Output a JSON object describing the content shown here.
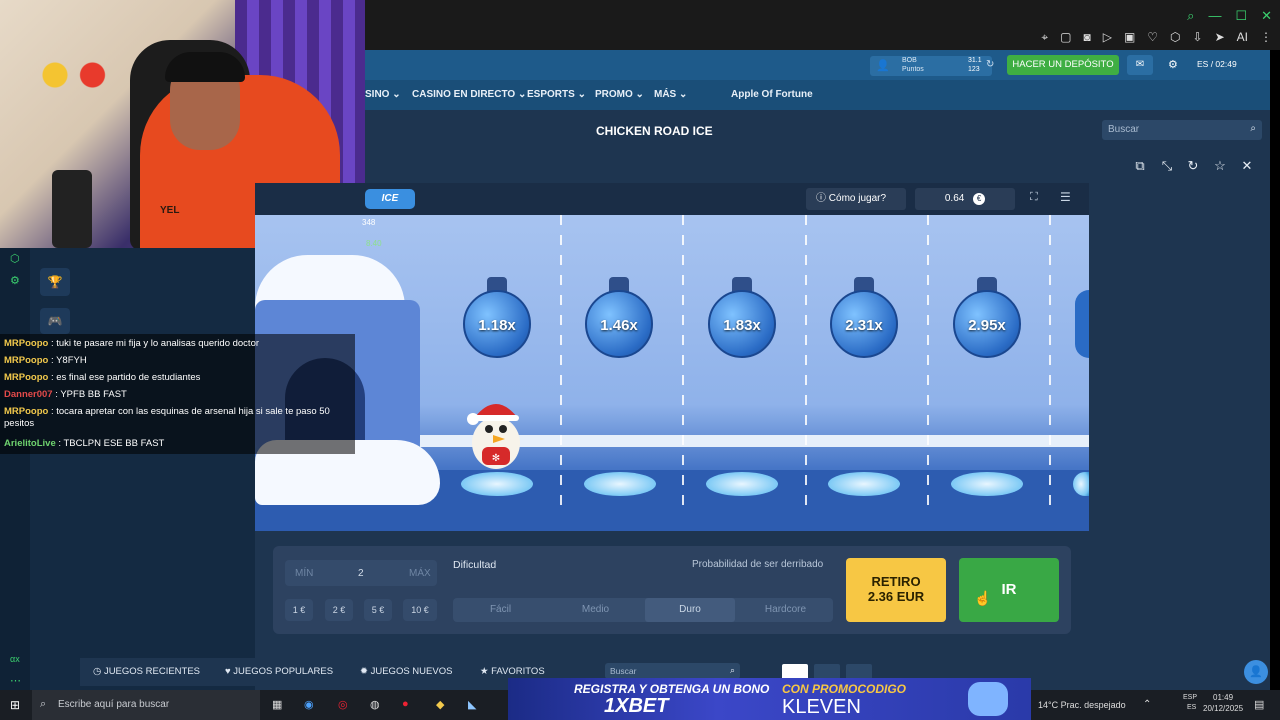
{
  "header": {
    "currency": "BOB",
    "points_label": "Puntos",
    "balance_top": "31.1",
    "balance_bottom": "123",
    "deposit_button": "HACER UN DEPÓSITO",
    "lang_time": "ES / 02:49"
  },
  "nav": {
    "items": [
      "SINO",
      "CASINO EN DIRECTO",
      "ESPORTS",
      "PROMO",
      "MÁS"
    ],
    "apple_label": "Apple Of Fortune"
  },
  "page": {
    "title": "CHICKEN ROAD ICE",
    "search_placeholder": "Buscar"
  },
  "game": {
    "logo_text": "ICE",
    "how_to_play": "Cómo jugar?",
    "balance": "0.64",
    "currency_icon": "€",
    "multipliers": [
      "1.18x",
      "1.46x",
      "1.83x",
      "2.31x",
      "2.95x"
    ],
    "overlay_id": "348",
    "overlay_win": "8.40"
  },
  "controls": {
    "min_label": "MÍN",
    "bet_value": "2",
    "max_label": "MÁX",
    "quick_bets": [
      "1",
      "2",
      "5",
      "10"
    ],
    "difficulty_label": "Dificultad",
    "shot_label": "Probabilidad de ser derribado",
    "difficulties": [
      "Fácil",
      "Medio",
      "Duro",
      "Hardcore"
    ],
    "selected_difficulty": "Duro",
    "cashout_line1": "RETIRO",
    "cashout_line2": "2.36 EUR",
    "go_button": "IR"
  },
  "bottom_nav": {
    "recent": "JUEGOS RECIENTES",
    "popular": "JUEGOS POPULARES",
    "new": "JUEGOS NUEVOS",
    "favorites": "FAVORITOS",
    "search_placeholder": "Buscar"
  },
  "chat": [
    {
      "user": "MRPoopo",
      "msg": " : tuki te pasare mi fija y lo analisas querido doctor",
      "style": "u"
    },
    {
      "user": "MRPoopo",
      "msg": " : Y8FYH",
      "style": "u"
    },
    {
      "user": "MRPoopo",
      "msg": " : es final ese partido de estudiantes",
      "style": "u"
    },
    {
      "user": "Danner007",
      "msg": " : YPFB BB FAST",
      "style": "u2"
    },
    {
      "user": "MRPoopo",
      "msg": " : tocara apretar con las esquinas de arsenal hija si sale te paso 50 pesitos",
      "style": "u"
    },
    {
      "user": "ArielitoLive",
      "msg": " : TBCLPN ESE BB FAST",
      "style": "u3"
    }
  ],
  "banner": {
    "line1_left": "REGISTRA Y OBTENGA UN BONO",
    "line1_right": "CON PROMOCODIGO",
    "brand": "1XBET",
    "code": "KLEVEN"
  },
  "taskbar": {
    "search_placeholder": "Escribe aquí para buscar",
    "weather": "14°C  Prac. despejado",
    "lang": "ESP",
    "lang2": "ES",
    "time": "01:49",
    "date": "20/12/2025"
  },
  "webcam_shirt_text": "YEL",
  "sidebar_tag": "αx",
  "colors": {
    "deposit": "#3fae43",
    "cashout": "#f7c744",
    "go": "#39a845",
    "header": "#1e5a8a"
  }
}
